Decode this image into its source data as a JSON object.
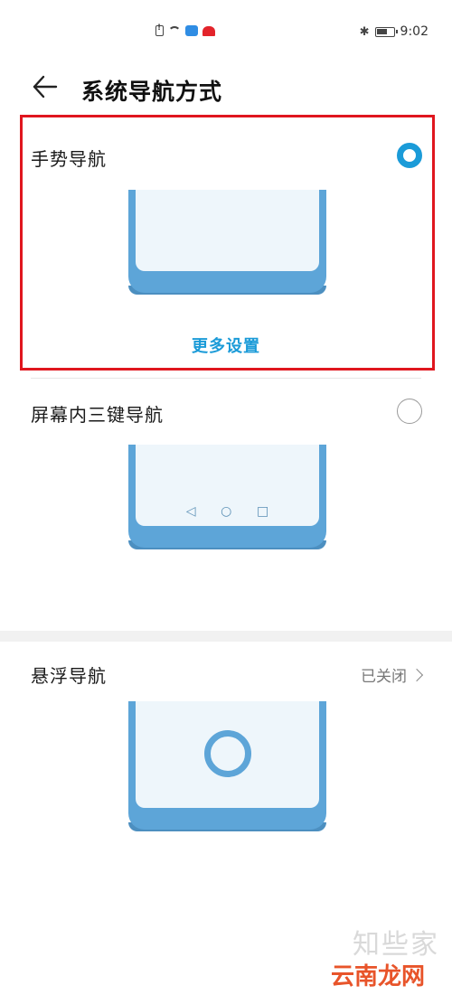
{
  "status_bar": {
    "time": "9:02",
    "icons": [
      "sim-alert-icon",
      "wifi-icon",
      "cloud-icon",
      "huawei-logo-icon",
      "bluetooth-icon",
      "battery-icon"
    ]
  },
  "header": {
    "back_icon": "arrow-left-icon",
    "title": "系统导航方式"
  },
  "options": [
    {
      "title": "手势导航",
      "selected": true,
      "more_settings_label": "更多设置"
    },
    {
      "title": "屏幕内三键导航",
      "selected": false,
      "nav_buttons": [
        "◁",
        "○",
        "□"
      ]
    },
    {
      "title": "悬浮导航",
      "status": "已关闭"
    }
  ],
  "colors": {
    "accent": "#1b9bd8",
    "phone_frame": "#5da5d8",
    "highlight": "#e0161e"
  },
  "watermark": {
    "top": "知些家",
    "main": "云南龙网"
  }
}
